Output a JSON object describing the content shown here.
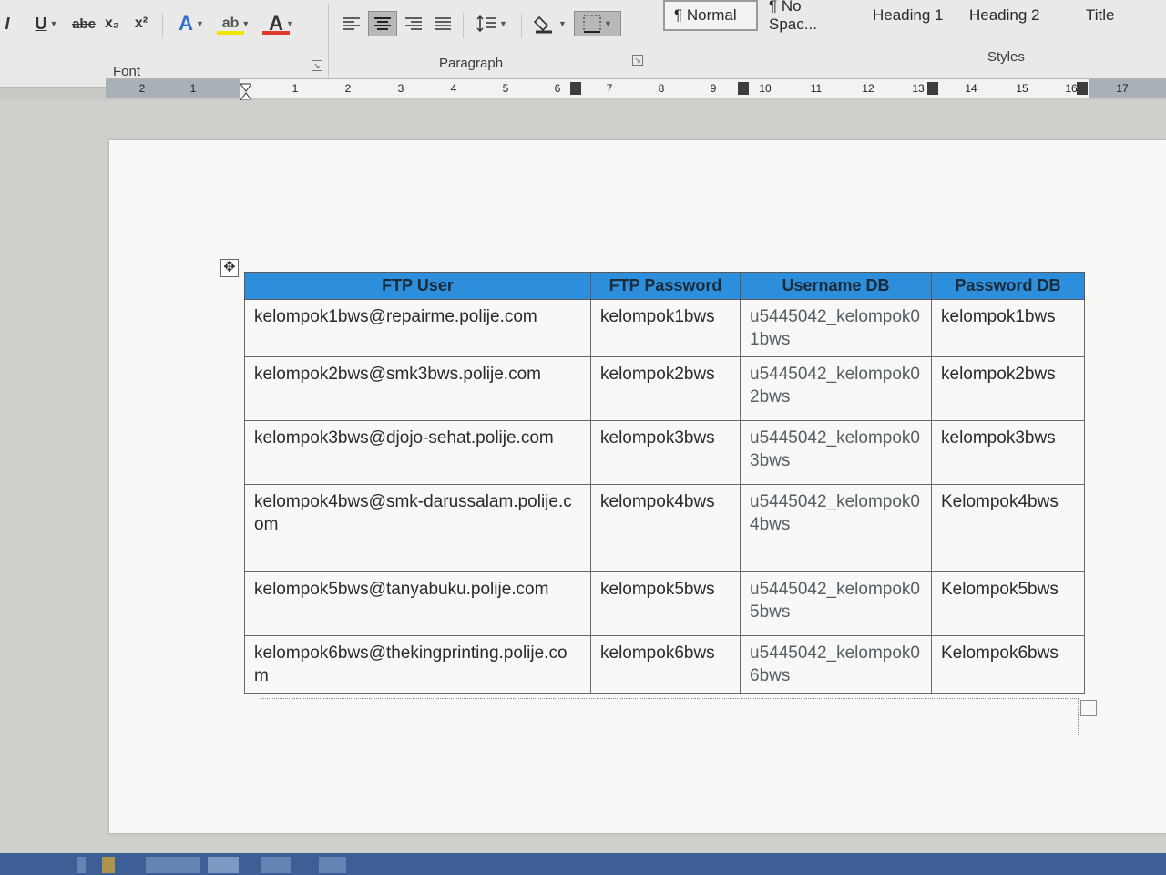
{
  "ribbon": {
    "font_group": {
      "label": "Font",
      "italic": "I",
      "underline": "U",
      "strikethrough": "abc",
      "subscript": "x₂",
      "superscript": "x²",
      "text_effects": "A",
      "highlight": "ab",
      "font_color": "A"
    },
    "paragraph_group": {
      "label": "Paragraph"
    },
    "styles_group": {
      "label": "Styles",
      "items": [
        "¶ Normal",
        "¶ No Spac...",
        "Heading 1",
        "Heading 2",
        "Title"
      ]
    }
  },
  "ruler": {
    "left_numbers": [
      "2",
      "1"
    ],
    "numbers": [
      "1",
      "2",
      "3",
      "4",
      "5",
      "6",
      "7",
      "8",
      "9",
      "10",
      "11",
      "12",
      "13",
      "14",
      "15",
      "16",
      "17"
    ]
  },
  "table": {
    "headers": [
      "FTP User",
      "FTP Password",
      "Username DB",
      "Password DB"
    ],
    "rows": [
      [
        "kelompok1bws@repairme.polije.com",
        "kelompok1bws",
        "u5445042_kelompok01bws",
        "kelompok1bws"
      ],
      [
        "kelompok2bws@smk3bws.polije.com",
        "kelompok2bws",
        "u5445042_kelompok02bws",
        "kelompok2bws"
      ],
      [
        "kelompok3bws@djojo-sehat.polije.com",
        "kelompok3bws",
        "u5445042_kelompok03bws",
        "kelompok3bws"
      ],
      [
        "kelompok4bws@smk-darussalam.polije.com",
        "kelompok4bws",
        "u5445042_kelompok04bws",
        "Kelompok4bws"
      ],
      [
        "kelompok5bws@tanyabuku.polije.com",
        "kelompok5bws",
        "u5445042_kelompok05bws",
        "Kelompok5bws"
      ],
      [
        "kelompok6bws@thekingprinting.polije.com",
        "kelompok6bws",
        "u5445042_kelompok06bws",
        "Kelompok6bws"
      ]
    ]
  },
  "colors": {
    "header_fill": "#2d8fdb",
    "font_color_bar": "#e03a2f",
    "highlight_bar": "#f2e600"
  }
}
